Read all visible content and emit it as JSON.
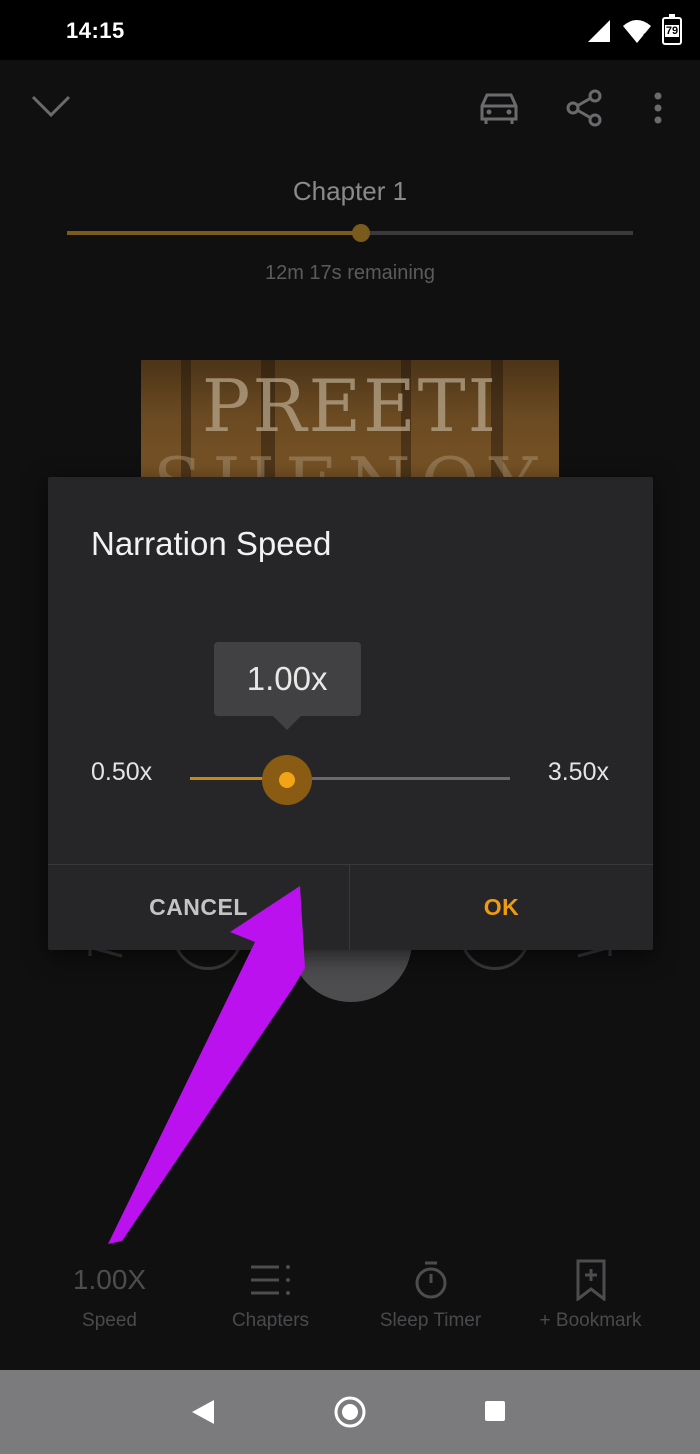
{
  "status_bar": {
    "time": "14:15",
    "battery_level": "79",
    "icons": [
      "signal-icon",
      "wifi-icon",
      "battery-icon"
    ]
  },
  "top_bar": {
    "icons": [
      "chevron-down-icon",
      "car-mode-icon",
      "share-icon",
      "more-vert-icon"
    ]
  },
  "player": {
    "chapter_title": "Chapter 1",
    "remaining": "12m 17s remaining",
    "chapter_progress": 0.52,
    "cover_text_line1": "PREETI",
    "cover_text_line2": "SHENOY"
  },
  "dialog": {
    "title": "Narration Speed",
    "current_value": "1.00x",
    "min_label": "0.50x",
    "max_label": "3.50x",
    "min": 0.5,
    "max": 3.5,
    "value": 1.0,
    "cancel_label": "CANCEL",
    "ok_label": "OK"
  },
  "bottom_nav": {
    "items": [
      {
        "top": "1.00X",
        "label": "Speed",
        "icon": "speed-text"
      },
      {
        "top": "",
        "label": "Chapters",
        "icon": "chapters-list-icon"
      },
      {
        "top": "",
        "label": "Sleep Timer",
        "icon": "timer-icon"
      },
      {
        "top": "",
        "label": "+ Bookmark",
        "icon": "bookmark-plus-icon"
      }
    ]
  },
  "colors": {
    "accent": "#f09a12",
    "dialog_bg": "#262628",
    "background": "#101011",
    "annotation_arrow": "#bb11ee"
  }
}
